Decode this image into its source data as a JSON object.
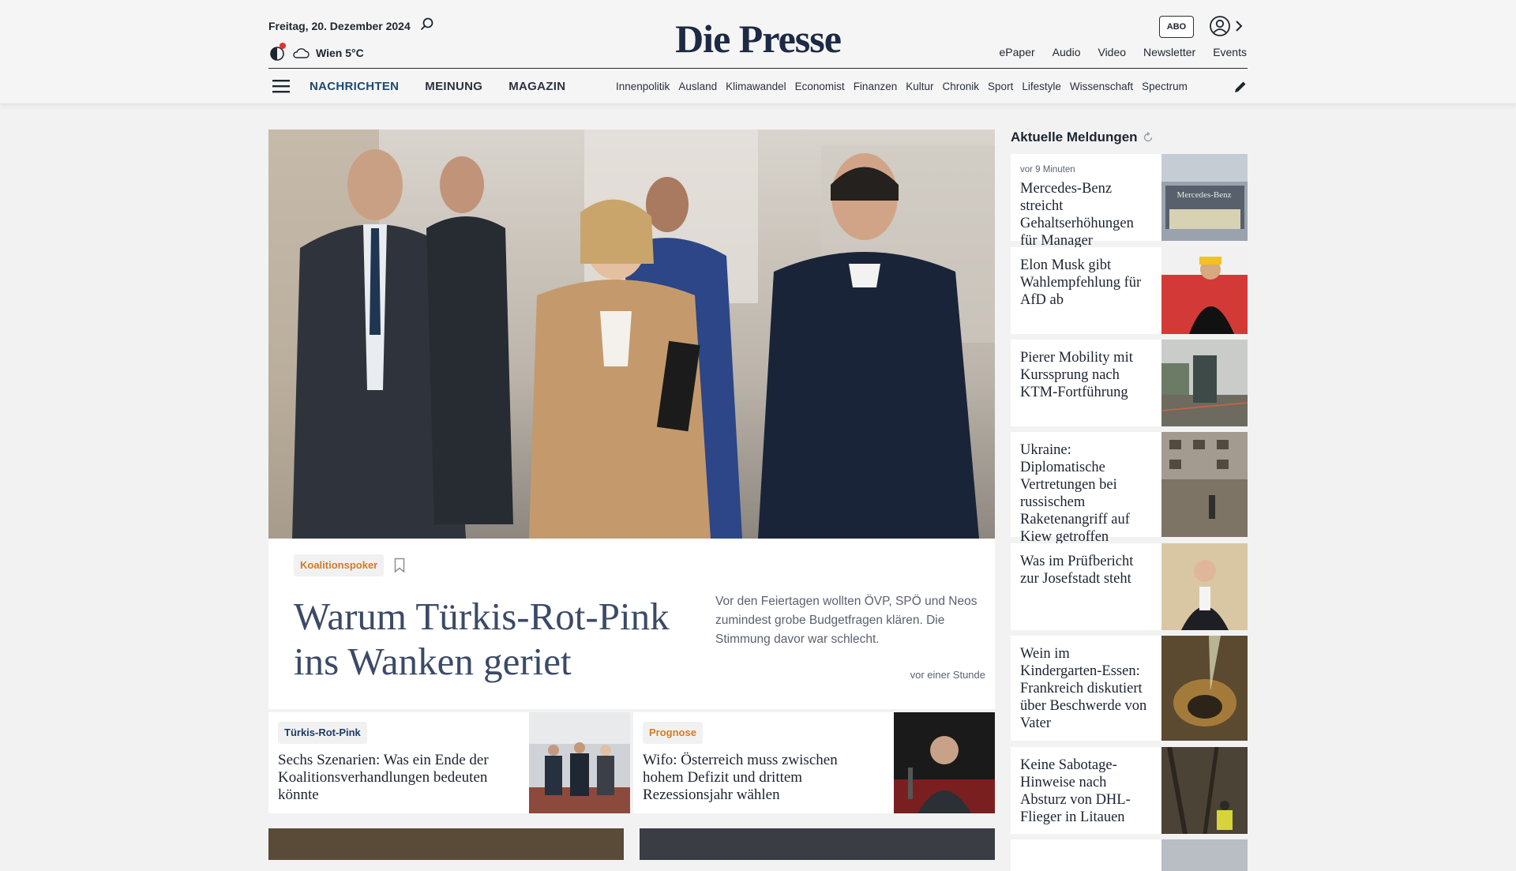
{
  "header": {
    "date": "Freitag, 20. Dezember 2024",
    "weather": "Wien 5°C",
    "logo": "Die Presse",
    "abo_label": "ABO",
    "top_links": [
      "ePaper",
      "Audio",
      "Video",
      "Newsletter",
      "Events"
    ],
    "main_nav": [
      "NACHRICHTEN",
      "MEINUNG",
      "MAGAZIN"
    ],
    "sub_nav": [
      "Innenpolitik",
      "Ausland",
      "Klimawandel",
      "Economist",
      "Finanzen",
      "Kultur",
      "Chronik",
      "Sport",
      "Lifestyle",
      "Wissenschaft",
      "Spectrum"
    ]
  },
  "hero": {
    "tag": "Koalitionspoker",
    "title": "Warum Türkis-Rot-Pink ins Wanken geriet",
    "teaser": "Vor den Feiertagen wollten ÖVP, SPÖ und Neos zumindest grobe Budgetfragen klären. Die Stimmung davor war schlecht.",
    "time": "vor einer Stunde"
  },
  "secondary": [
    {
      "tag": "Türkis-Rot-Pink",
      "title": "Sechs Szenarien: Was ein Ende der Koalitionsverhandlungen bedeuten könnte"
    },
    {
      "tag": "Prognose",
      "title": "Wifo: Österreich muss zwischen hohem Defizit und drittem Rezessionsjahr wählen"
    }
  ],
  "sidebar": {
    "heading": "Aktuelle Meldungen",
    "items": [
      {
        "time": "vor 9 Minuten",
        "title": "Mercedes-Benz streicht Gehaltserhöhungen für Manager",
        "img_text": "Mercedes-Benz"
      },
      {
        "title": "Elon Musk gibt Wahlempfehlung für AfD ab"
      },
      {
        "title": "Pierer Mobility mit Kurssprung nach KTM-Fortführung"
      },
      {
        "title": "Ukraine: Diplomatische Vertretungen bei russischem Raketenangriff auf Kiew getroffen"
      },
      {
        "title": "Was im Prüfbericht zur Josefstadt steht"
      },
      {
        "title": "Wein im Kindergarten-Essen: Frankreich diskutiert über Beschwerde von Vater"
      },
      {
        "title": "Keine Sabotage-Hinweise nach Absturz von DHL-Flieger in Litauen"
      }
    ]
  }
}
